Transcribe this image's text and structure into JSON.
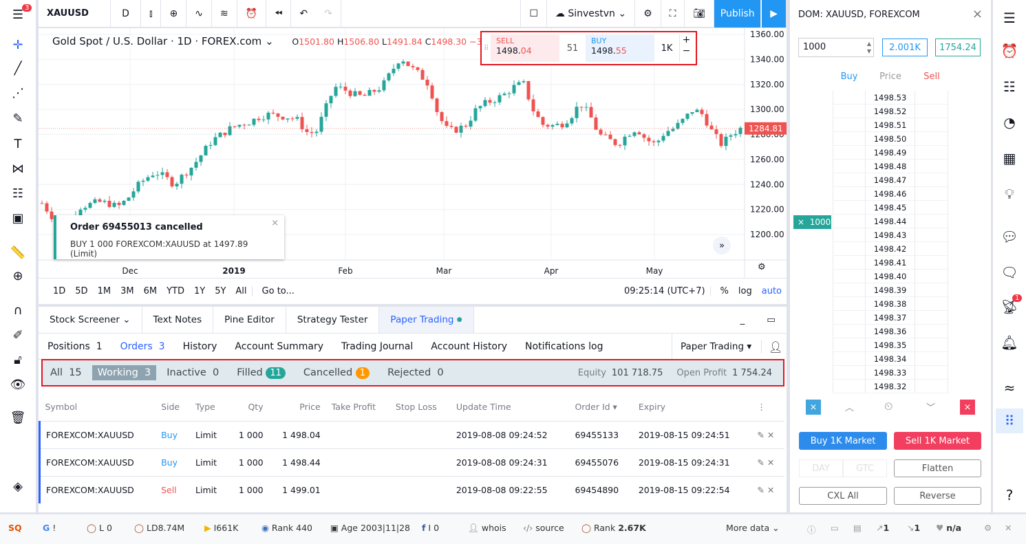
{
  "topbar": {
    "symbol": "XAUUSD",
    "interval": "D",
    "account": "Sinvestvn",
    "publish": "Publish",
    "menu_badge": "3"
  },
  "chart": {
    "title": "Gold Spot / U.S. Dollar · 1D · FOREX.com",
    "ohlc": {
      "o_label": "O",
      "o": "1501.80",
      "h_label": "H",
      "h": "1506.80",
      "l_label": "L",
      "l": "1491.84",
      "c_label": "C",
      "c": "1498.30",
      "chg": "−3.5"
    },
    "trade_widget": {
      "sell_label": "SELL",
      "sell_price_main": "1498.",
      "sell_price_tail": "04",
      "spread": "51",
      "buy_label": "BUY",
      "buy_price_main": "1498.",
      "buy_price_tail": "55",
      "qty": "1K",
      "plus": "+",
      "minus": "−"
    },
    "price_ticks": [
      "1360.00",
      "1340.00",
      "1320.00",
      "1300.00",
      "1280.00",
      "1260.00",
      "1240.00",
      "1220.00",
      "1200.00"
    ],
    "last_price": "1284.81",
    "time_ticks": [
      "Dec",
      "2019",
      "Feb",
      "Mar",
      "Apr",
      "May"
    ],
    "toast": {
      "title": "Order 69455013 cancelled",
      "body": "BUY 1 000 FOREXCOM:XAUUSD at 1497.89 (Limit)"
    },
    "colors": {
      "up": "#26a69a",
      "down": "#ef5350"
    }
  },
  "chart_data": {
    "type": "candlestick",
    "ylim": [
      1190,
      1365
    ],
    "approx_closes": [
      1225,
      1215,
      1208,
      1212,
      1222,
      1224,
      1226,
      1225,
      1222,
      1228,
      1238,
      1245,
      1250,
      1246,
      1240,
      1248,
      1255,
      1265,
      1275,
      1280,
      1285,
      1288,
      1290,
      1294,
      1296,
      1295,
      1294,
      1292,
      1282,
      1281,
      1300,
      1318,
      1316,
      1312,
      1310,
      1314,
      1318,
      1330,
      1342,
      1334,
      1328,
      1320,
      1295,
      1283,
      1284,
      1288,
      1300,
      1305,
      1308,
      1312,
      1318,
      1321,
      1300,
      1288,
      1287,
      1288,
      1294,
      1305,
      1296,
      1280,
      1276,
      1272,
      1280,
      1285,
      1276,
      1272,
      1282,
      1285,
      1292,
      1300,
      1296,
      1282,
      1272,
      1280,
      1284.81
    ]
  },
  "ranges": {
    "items": [
      "1D",
      "5D",
      "1M",
      "3M",
      "6M",
      "YTD",
      "1Y",
      "5Y",
      "All"
    ],
    "goto": "Go to...",
    "clock": "09:25:14 (UTC+7)",
    "pct": "%",
    "log": "log",
    "auto": "auto"
  },
  "bottom": {
    "tabs": [
      "Stock Screener",
      "Text Notes",
      "Pine Editor",
      "Strategy Tester",
      "Paper Trading"
    ],
    "subtabs": [
      {
        "label": "Positions",
        "count": "1"
      },
      {
        "label": "Orders",
        "count": "3"
      },
      {
        "label": "History"
      },
      {
        "label": "Account Summary"
      },
      {
        "label": "Trading Journal"
      },
      {
        "label": "Account History"
      },
      {
        "label": "Notifications log"
      }
    ],
    "broker": "Paper Trading",
    "filters": {
      "all": "All",
      "all_n": "15",
      "working": "Working",
      "working_n": "3",
      "inactive": "Inactive",
      "inactive_n": "0",
      "filled": "Filled",
      "filled_n": "11",
      "cancelled": "Cancelled",
      "cancelled_n": "1",
      "rejected": "Rejected",
      "rejected_n": "0",
      "equity_label": "Equity",
      "equity": "101 718.75",
      "op_label": "Open Profit",
      "op": "1 754.24"
    },
    "columns": [
      "Symbol",
      "Side",
      "Type",
      "Qty",
      "Price",
      "Take Profit",
      "Stop Loss",
      "Update Time",
      "Order Id",
      "Expiry"
    ],
    "rows": [
      {
        "symbol": "FOREXCOM:XAUUSD",
        "side": "Buy",
        "type": "Limit",
        "qty": "1 000",
        "price": "1 498.04",
        "tp": "",
        "sl": "",
        "time": "2019-08-08 09:24:52",
        "id": "69455133",
        "expiry": "2019-08-15 09:24:51"
      },
      {
        "symbol": "FOREXCOM:XAUUSD",
        "side": "Buy",
        "type": "Limit",
        "qty": "1 000",
        "price": "1 498.44",
        "tp": "",
        "sl": "",
        "time": "2019-08-08 09:24:31",
        "id": "69455076",
        "expiry": "2019-08-15 09:24:31"
      },
      {
        "symbol": "FOREXCOM:XAUUSD",
        "side": "Sell",
        "type": "Limit",
        "qty": "1 000",
        "price": "1 499.01",
        "tp": "",
        "sl": "",
        "time": "2019-08-08 09:22:55",
        "id": "69454890",
        "expiry": "2019-08-15 09:22:54"
      }
    ]
  },
  "dom": {
    "title": "DOM: XAUUSD, FOREXCOM",
    "qty": "1000",
    "btn1": "2.001K",
    "btn2": "1754.24",
    "buy": "Buy",
    "price": "Price",
    "sell": "Sell",
    "prices": [
      "1498.53",
      "1498.52",
      "1498.51",
      "1498.50",
      "1498.49",
      "1498.48",
      "1498.47",
      "1498.46",
      "1498.45",
      "1498.44",
      "1498.43",
      "1498.42",
      "1498.41",
      "1498.40",
      "1498.39",
      "1498.38",
      "1498.37",
      "1498.36",
      "1498.35",
      "1498.34",
      "1498.33",
      "1498.32"
    ],
    "order_qty": "1000",
    "buy_market": "Buy 1K Market",
    "sell_market": "Sell 1K Market",
    "day": "DAY",
    "gtc": "GTC",
    "flatten": "Flatten",
    "cxl": "CXL All",
    "reverse": "Reverse"
  },
  "rightsb": {
    "badge": "1"
  },
  "status": {
    "g": "!",
    "l": "0",
    "ld": "8.74M",
    "bing": "661K",
    "rank1": "440",
    "age": "2003|11|28",
    "fb": "0",
    "whois": "whois",
    "source": "source",
    "rank2": "2.67K",
    "more": "More data",
    "ext": "1",
    "int": "1",
    "na": "n/a",
    "l_label": "L",
    "ld_label": "LD",
    "rank_label": "Rank",
    "age_label": "Age"
  }
}
